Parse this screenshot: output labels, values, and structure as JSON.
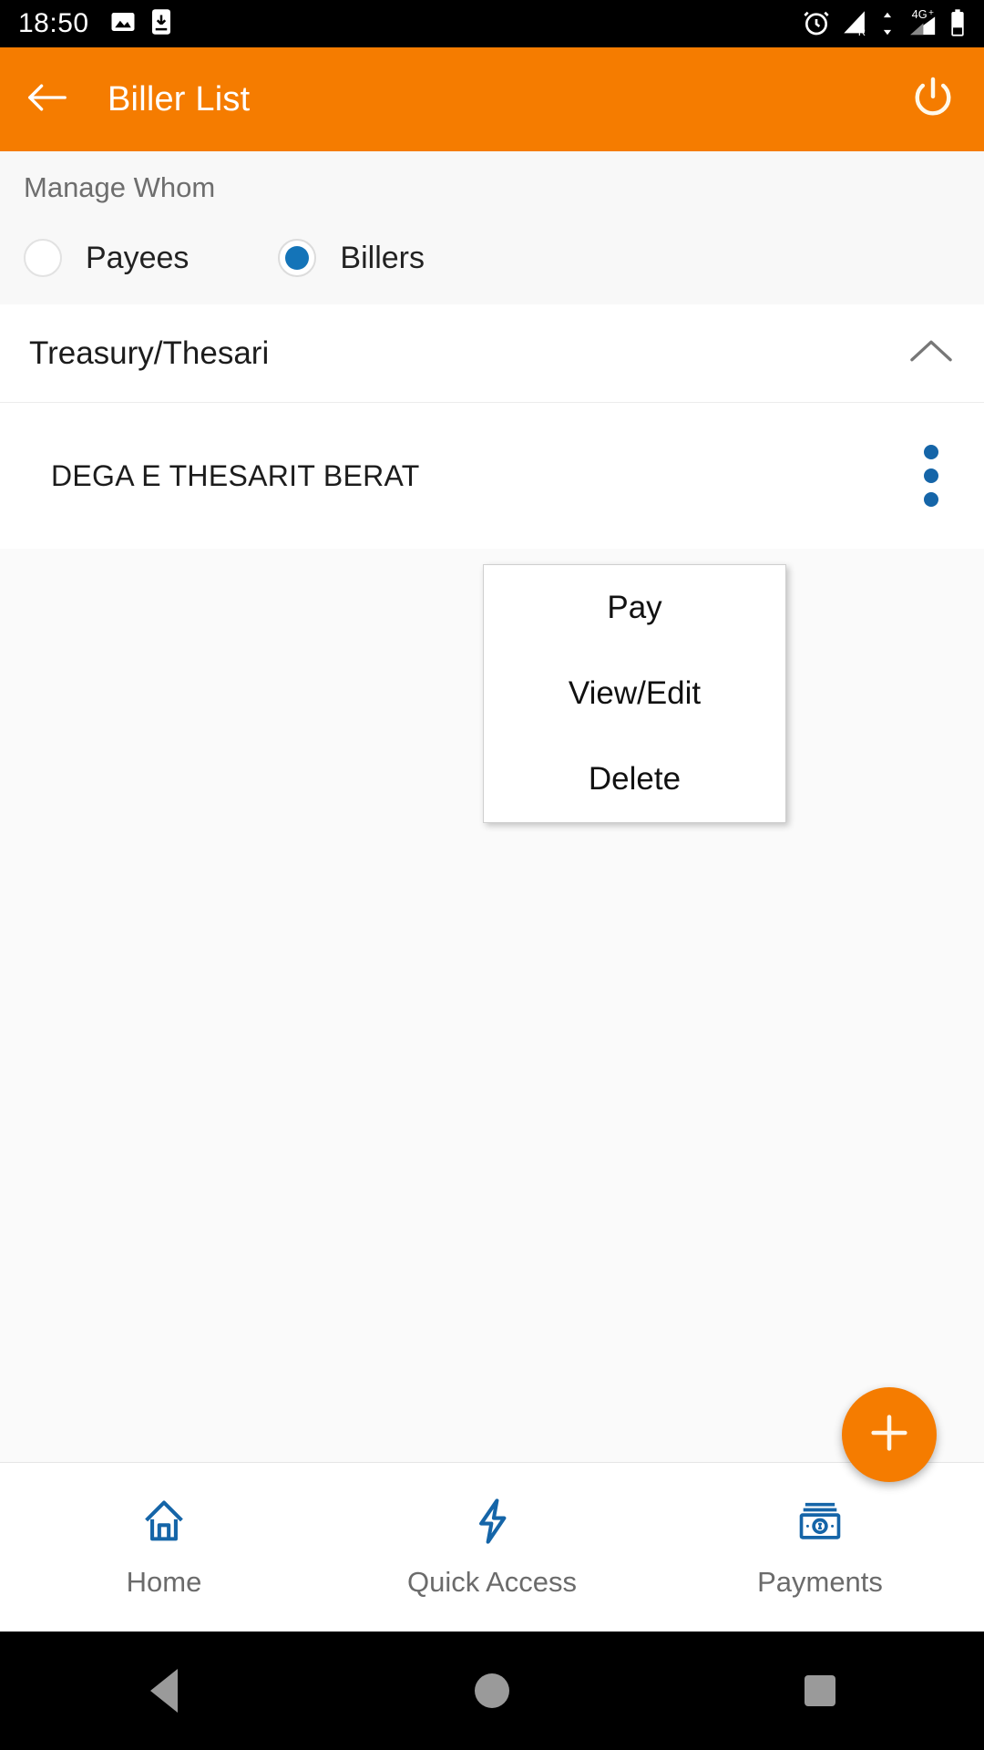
{
  "status_bar": {
    "time": "18:50",
    "left_icons": [
      "image-icon",
      "download-to-device-icon"
    ],
    "right_icons": [
      "alarm-icon",
      "signal-roaming-icon",
      "4g-plus-signal-icon",
      "battery-icon"
    ],
    "network_label": "4G+",
    "roaming_label": "R"
  },
  "app_bar": {
    "back_icon": "back-arrow-icon",
    "title": "Biller List",
    "power_icon": "power-icon",
    "color": "#F57C00"
  },
  "manage_section": {
    "label": "Manage Whom",
    "options": [
      {
        "label": "Payees",
        "selected": false
      },
      {
        "label": "Billers",
        "selected": true
      }
    ],
    "selected_color": "#1474b8"
  },
  "list": {
    "group": {
      "title": "Treasury/Thesari",
      "expanded": true,
      "toggle_icon": "chevron-up-icon"
    },
    "billers": [
      {
        "name": "DEGA E THESARIT BERAT",
        "overflow_icon": "more-vertical-icon"
      }
    ]
  },
  "popup_menu": {
    "items": [
      "Pay",
      "View/Edit",
      "Delete"
    ]
  },
  "fab": {
    "icon": "plus-icon",
    "color": "#F57C00"
  },
  "bottom_nav": {
    "items": [
      {
        "label": "Home",
        "icon": "home-icon"
      },
      {
        "label": "Quick Access",
        "icon": "lightning-bolt-icon"
      },
      {
        "label": "Payments",
        "icon": "banknote-icon"
      }
    ],
    "icon_color": "#1565a8"
  },
  "android_nav": {
    "items": [
      "back-triangle-icon",
      "home-circle-icon",
      "recent-apps-square-icon"
    ]
  }
}
